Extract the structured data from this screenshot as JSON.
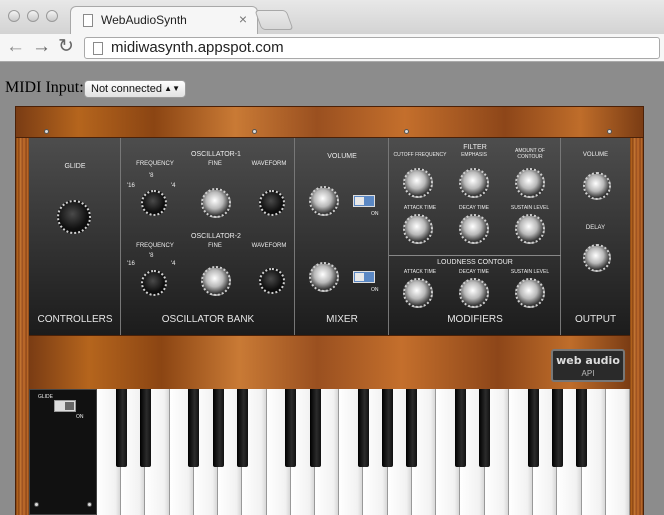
{
  "browser": {
    "tab_title": "WebAudioSynth",
    "tab_close": "×",
    "back": "←",
    "forward": "→",
    "reload": "↻",
    "url": "midiwasynth.appspot.com"
  },
  "midi": {
    "label": "MIDI Input:",
    "selected": "Not connected"
  },
  "controllers": {
    "glide_label": "GLIDE",
    "section_title": "CONTROLLERS"
  },
  "oscillator_bank": {
    "osc1_title": "OSCILLATOR-1",
    "osc2_title": "OSCILLATOR-2",
    "frequency_label": "FREQUENCY",
    "fine_label": "FINE",
    "waveform_label": "WAVEFORM",
    "footages": [
      "'16",
      "'8",
      "'4"
    ],
    "section_title": "OSCILLATOR BANK"
  },
  "mixer": {
    "volume_label": "VOLUME",
    "on_label": "ON",
    "section_title": "MIXER"
  },
  "filter": {
    "title": "FILTER",
    "cutoff_label": "CUTOFF FREQUENCY",
    "emphasis_label": "EMPHASIS",
    "amount_label": "AMOUNT OF CONTOUR",
    "attack_label": "ATTACK TIME",
    "decay_label": "DECAY TIME",
    "sustain_label": "SUSTAIN LEVEL"
  },
  "loudness": {
    "title": "LOUDNESS CONTOUR",
    "attack_label": "ATTACK TIME",
    "decay_label": "DECAY TIME",
    "sustain_label": "SUSTAIN LEVEL",
    "section_title": "MODIFIERS"
  },
  "output": {
    "volume_label": "VOLUME",
    "delay_label": "DELAY",
    "section_title": "OUTPUT"
  },
  "badge": {
    "line1": "web audio",
    "line2": "API"
  },
  "glide_switch": {
    "label": "GLIDE",
    "on_label": "ON"
  },
  "keyboard": {
    "white_keys": 22,
    "black_pattern": [
      1,
      1,
      0,
      1,
      1,
      1,
      0
    ]
  }
}
